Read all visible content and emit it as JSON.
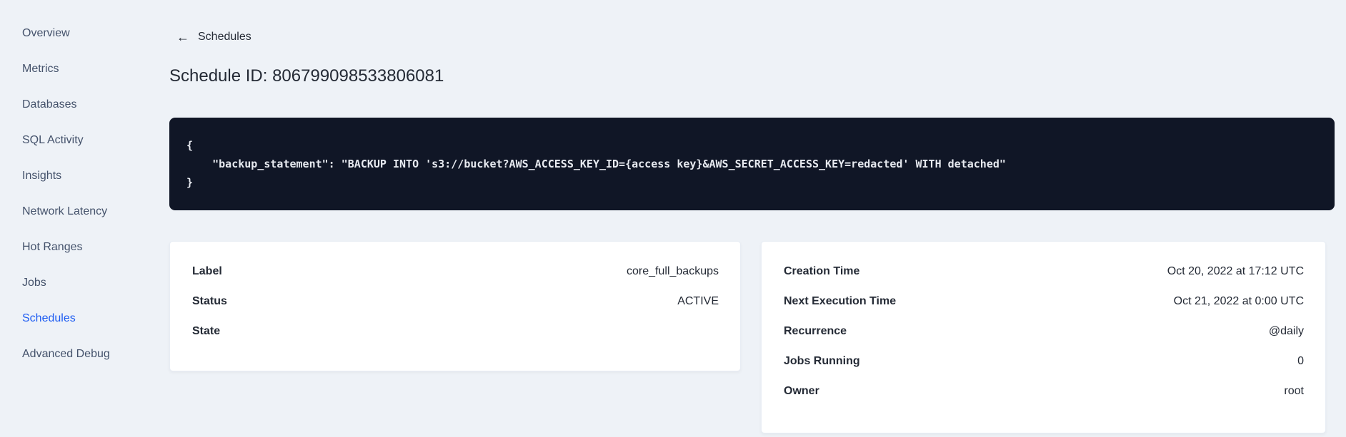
{
  "sidebar": {
    "items": [
      {
        "label": "Overview",
        "active": false
      },
      {
        "label": "Metrics",
        "active": false
      },
      {
        "label": "Databases",
        "active": false
      },
      {
        "label": "SQL Activity",
        "active": false
      },
      {
        "label": "Insights",
        "active": false
      },
      {
        "label": "Network Latency",
        "active": false
      },
      {
        "label": "Hot Ranges",
        "active": false
      },
      {
        "label": "Jobs",
        "active": false
      },
      {
        "label": "Schedules",
        "active": true
      },
      {
        "label": "Advanced Debug",
        "active": false
      }
    ]
  },
  "header": {
    "back_icon_glyph": "←",
    "back_label": "Schedules",
    "title": "Schedule ID: 806799098533806081"
  },
  "code_block": {
    "text": "{\n    \"backup_statement\": \"BACKUP INTO 's3://bucket?AWS_ACCESS_KEY_ID={access key}&AWS_SECRET_ACCESS_KEY=redacted' WITH detached\"\n}"
  },
  "left_card": {
    "rows": [
      {
        "label": "Label",
        "value": "core_full_backups"
      },
      {
        "label": "Status",
        "value": "ACTIVE"
      },
      {
        "label": "State",
        "value": ""
      }
    ]
  },
  "right_card": {
    "rows": [
      {
        "label": "Creation Time",
        "value": "Oct 20, 2022 at 17:12 UTC"
      },
      {
        "label": "Next Execution Time",
        "value": "Oct 21, 2022 at 0:00 UTC"
      },
      {
        "label": "Recurrence",
        "value": "@daily"
      },
      {
        "label": "Jobs Running",
        "value": "0"
      },
      {
        "label": "Owner",
        "value": "root"
      }
    ]
  },
  "colors": {
    "page_background": "#eef2f7",
    "card_background": "#ffffff",
    "code_background": "#101626",
    "code_text": "#e7eaf0",
    "sidebar_text": "#44526b",
    "sidebar_active": "#1d5cf2",
    "heading_text": "#242a35"
  }
}
